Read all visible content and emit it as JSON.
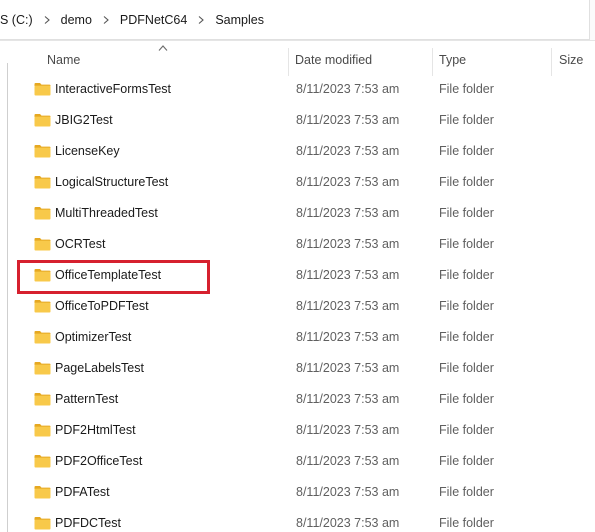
{
  "breadcrumb": {
    "items": [
      "S (C:)",
      "demo",
      "PDFNetC64",
      "Samples"
    ]
  },
  "columns": {
    "name": "Name",
    "date_modified": "Date modified",
    "type": "Type",
    "size": "Size",
    "sort": "name-ascending"
  },
  "files": [
    {
      "name": "InteractiveFormsTest",
      "date": "8/11/2023 7:53 am",
      "type": "File folder"
    },
    {
      "name": "JBIG2Test",
      "date": "8/11/2023 7:53 am",
      "type": "File folder"
    },
    {
      "name": "LicenseKey",
      "date": "8/11/2023 7:53 am",
      "type": "File folder"
    },
    {
      "name": "LogicalStructureTest",
      "date": "8/11/2023 7:53 am",
      "type": "File folder"
    },
    {
      "name": "MultiThreadedTest",
      "date": "8/11/2023 7:53 am",
      "type": "File folder"
    },
    {
      "name": "OCRTest",
      "date": "8/11/2023 7:53 am",
      "type": "File folder"
    },
    {
      "name": "OfficeTemplateTest",
      "date": "8/11/2023 7:53 am",
      "type": "File folder",
      "highlighted": true
    },
    {
      "name": "OfficeToPDFTest",
      "date": "8/11/2023 7:53 am",
      "type": "File folder"
    },
    {
      "name": "OptimizerTest",
      "date": "8/11/2023 7:53 am",
      "type": "File folder"
    },
    {
      "name": "PageLabelsTest",
      "date": "8/11/2023 7:53 am",
      "type": "File folder"
    },
    {
      "name": "PatternTest",
      "date": "8/11/2023 7:53 am",
      "type": "File folder"
    },
    {
      "name": "PDF2HtmlTest",
      "date": "8/11/2023 7:53 am",
      "type": "File folder"
    },
    {
      "name": "PDF2OfficeTest",
      "date": "8/11/2023 7:53 am",
      "type": "File folder"
    },
    {
      "name": "PDFATest",
      "date": "8/11/2023 7:53 am",
      "type": "File folder"
    },
    {
      "name": "PDFDCTest",
      "date": "8/11/2023 7:53 am",
      "type": "File folder"
    }
  ],
  "icons": {
    "folder": "folder-icon",
    "separator": "chevron-right-icon",
    "sort": "sort-ascending-icon"
  },
  "colors": {
    "folder_body": "#f8c94a",
    "folder_tab": "#e6a821",
    "highlight": "#d6202e"
  }
}
